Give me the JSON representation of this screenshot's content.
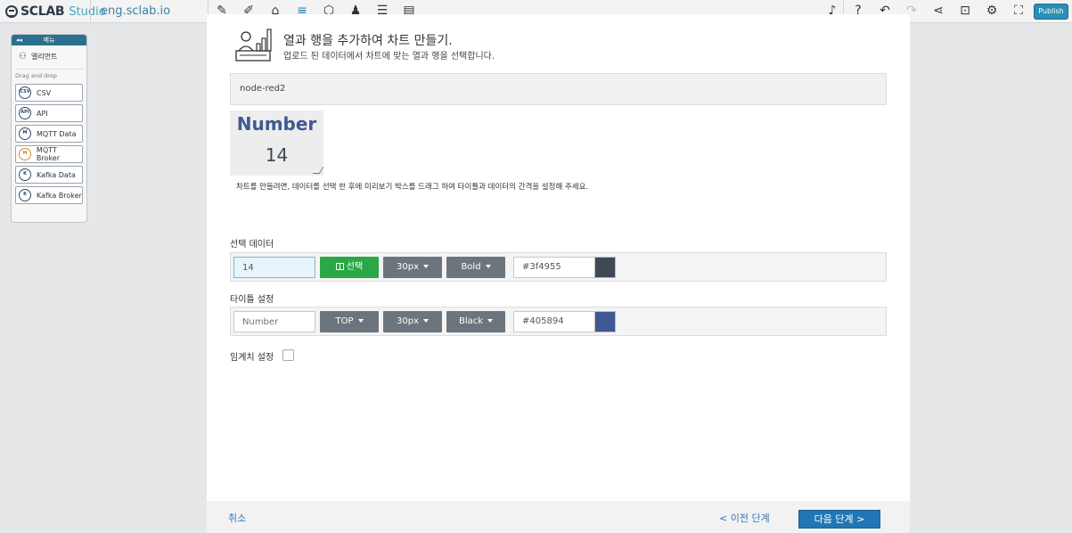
{
  "app": {
    "brand": "SCLAB",
    "brand_suffix": "Studio",
    "domain": "eng.sclab.io",
    "publish_label": "Publish"
  },
  "palette": {
    "header_title": "메뉴",
    "element_label": "엘리먼트",
    "drag_drop_label": "Drag and drop",
    "nodes": [
      {
        "label": "CSV",
        "icon": "csv-icon"
      },
      {
        "label": "API",
        "icon": "api-icon"
      },
      {
        "label": "MQTT Data",
        "icon": "mqtt-icon"
      },
      {
        "label": "MQTT Broker",
        "icon": "mqtt-broker-icon"
      },
      {
        "label": "Kafka Data",
        "icon": "kafka-icon"
      },
      {
        "label": "Kafka Broker",
        "icon": "kafka-broker-icon"
      }
    ]
  },
  "modal": {
    "title": "열과 행을 추가하여 차트 만들기.",
    "subtitle": "업로드 된 데이터에서 차트에 맞는 열과 행을 선택합니다.",
    "node_name": "node-red2",
    "preview": {
      "title": "Number",
      "value": "14"
    },
    "hint": "차트를 만들려면, 데이터를 선택 한 후에 미리보기 박스를 드래그 하여 타이틀과 데이터의 간격을 설정해 주세요.",
    "data_section": {
      "label": "선택 데이터",
      "value": "14",
      "select_label": "선택",
      "font_size": "30px",
      "font_weight": "Bold",
      "color_hex": "#3f4955",
      "color": "#3f4955"
    },
    "title_section": {
      "label": "타이틀 설정",
      "placeholder": "Number",
      "position": "TOP",
      "font_size": "30px",
      "font_weight": "Black",
      "color_hex": "#405894",
      "color": "#405894"
    },
    "threshold_label": "임계치 설정",
    "footer": {
      "cancel": "취소",
      "prev": "< 이전 단계",
      "next": "다음 단계 >"
    }
  }
}
